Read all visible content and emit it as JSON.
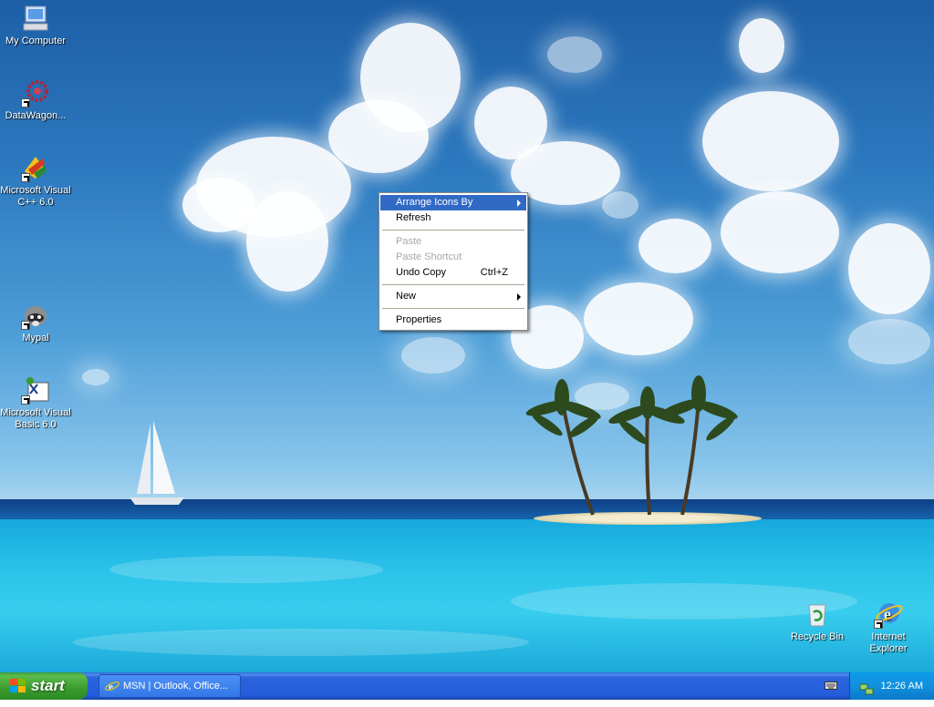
{
  "desktop": {
    "icons_left": [
      {
        "label": "My Computer",
        "icon": "my-computer-icon"
      },
      {
        "label": "DataWagon...",
        "icon": "datawagon-icon"
      },
      {
        "label": "Microsoft Visual C++ 6.0",
        "icon": "visual-cpp-icon"
      },
      {
        "label": "Mypal",
        "icon": "mypal-raccoon-icon"
      },
      {
        "label": "Microsoft Visual Basic 6.0",
        "icon": "visual-basic-icon"
      }
    ],
    "icons_right": [
      {
        "label": "Recycle Bin",
        "icon": "recycle-bin-icon"
      },
      {
        "label": "Internet Explorer",
        "icon": "internet-explorer-icon"
      }
    ]
  },
  "context_menu": {
    "items": [
      {
        "label": "Arrange Icons By",
        "submenu": true,
        "highlighted": true,
        "disabled": false
      },
      {
        "label": "Refresh",
        "submenu": false,
        "disabled": false
      },
      {
        "label": "Paste",
        "submenu": false,
        "disabled": true
      },
      {
        "label": "Paste Shortcut",
        "submenu": false,
        "disabled": true
      },
      {
        "label": "Undo Copy",
        "shortcut": "Ctrl+Z",
        "submenu": false,
        "disabled": false
      },
      {
        "label": "New",
        "submenu": true,
        "disabled": false
      },
      {
        "label": "Properties",
        "submenu": false,
        "disabled": false
      }
    ]
  },
  "taskbar": {
    "start_label": "start",
    "tasks": [
      {
        "label": "MSN | Outlook, Office...",
        "icon": "internet-explorer-icon"
      }
    ],
    "tray": {
      "time": "12:26 AM",
      "icons": [
        "keyboard-icon",
        "network-icon"
      ]
    }
  },
  "colors": {
    "menu_highlight": "#316ac5",
    "taskbar_blue": "#245edb",
    "start_green": "#3a9a2e",
    "tray_blue": "#0f8fdc"
  }
}
